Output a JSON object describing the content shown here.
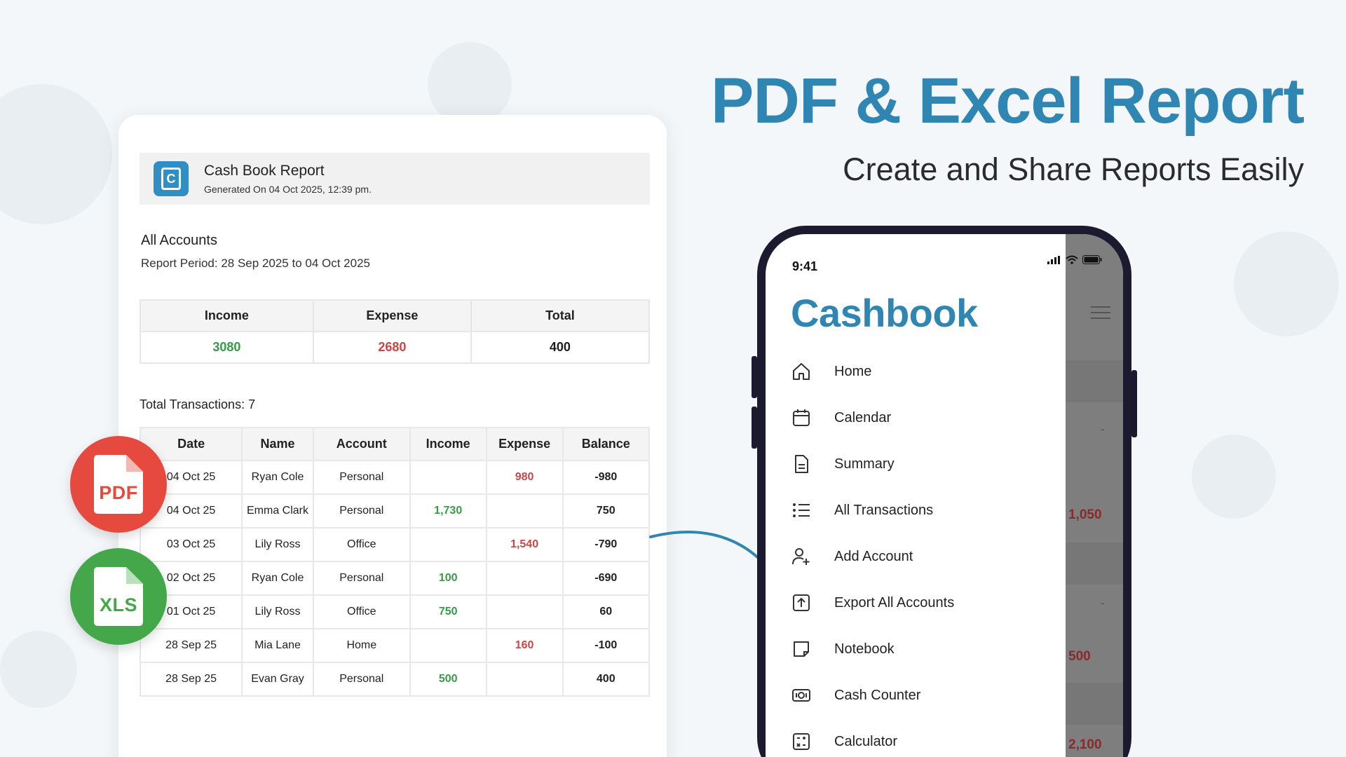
{
  "headline": "PDF & Excel Report",
  "subheadline": "Create and Share Reports Easily",
  "report": {
    "logo_letter": "C",
    "title": "Cash Book Report",
    "generated": "Generated On 04 Oct 2025, 12:39 pm.",
    "accounts_label": "All Accounts",
    "period": "Report Period:  28 Sep 2025 to 04 Oct 2025",
    "summary": {
      "headers": [
        "Income",
        "Expense",
        "Total"
      ],
      "values": [
        "3080",
        "2680",
        "400"
      ]
    },
    "total_transactions": "Total Transactions: 7",
    "columns": [
      "Date",
      "Name",
      "Account",
      "Income",
      "Expense",
      "Balance"
    ],
    "rows": [
      {
        "date": "04 Oct 25",
        "name": "Ryan Cole",
        "account": "Personal",
        "income": "",
        "expense": "980",
        "balance": "-980"
      },
      {
        "date": "04 Oct 25",
        "name": "Emma Clark",
        "account": "Personal",
        "income": "1,730",
        "expense": "",
        "balance": "750"
      },
      {
        "date": "03 Oct 25",
        "name": "Lily Ross",
        "account": "Office",
        "income": "",
        "expense": "1,540",
        "balance": "-790"
      },
      {
        "date": "02 Oct 25",
        "name": "Ryan Cole",
        "account": "Personal",
        "income": "100",
        "expense": "",
        "balance": "-690"
      },
      {
        "date": "01 Oct 25",
        "name": "Lily Ross",
        "account": "Office",
        "income": "750",
        "expense": "",
        "balance": "60"
      },
      {
        "date": "28 Sep 25",
        "name": "Mia Lane",
        "account": "Home",
        "income": "",
        "expense": "160",
        "balance": "-100"
      },
      {
        "date": "28 Sep 25",
        "name": "Evan Gray",
        "account": "Personal",
        "income": "500",
        "expense": "",
        "balance": "400"
      }
    ]
  },
  "badges": {
    "pdf_label": "PDF",
    "xls_label": "XLS"
  },
  "phone": {
    "status_time": "9:41",
    "drawer_title": "Cashbook",
    "menu": [
      {
        "label": "Home",
        "icon": "home-icon"
      },
      {
        "label": "Calendar",
        "icon": "calendar-icon"
      },
      {
        "label": "Summary",
        "icon": "document-icon"
      },
      {
        "label": "All Transactions",
        "icon": "list-icon"
      },
      {
        "label": "Add Account",
        "icon": "add-user-icon"
      },
      {
        "label": "Export All Accounts",
        "icon": "export-icon"
      },
      {
        "label": "Notebook",
        "icon": "note-icon"
      },
      {
        "label": "Cash Counter",
        "icon": "cash-icon"
      },
      {
        "label": "Calculator",
        "icon": "calculator-icon"
      }
    ],
    "background_values": [
      "-",
      "1,050",
      "-",
      "500",
      "2,100"
    ]
  },
  "colors": {
    "brand_blue": "#2f86b3",
    "income_green": "#3a9a48",
    "expense_red": "#c94646",
    "pdf_red": "#e64a3e",
    "xls_green": "#44a84b"
  }
}
